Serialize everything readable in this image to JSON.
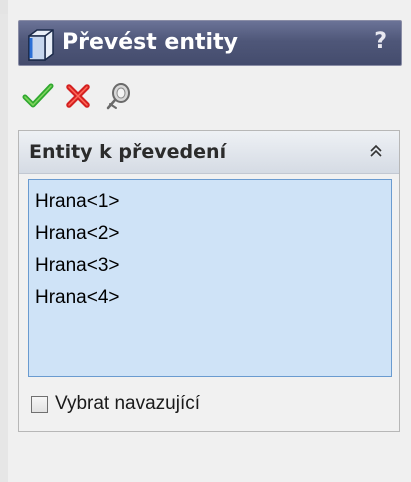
{
  "panel": {
    "title": "Převést entity",
    "help_label": "?"
  },
  "toolbar": {
    "ok_icon": "checkmark-icon",
    "cancel_icon": "x-icon",
    "pushpin_icon": "pushpin-icon"
  },
  "group": {
    "title": "Entity k převedení",
    "items": [
      {
        "label": "Hrana<1>"
      },
      {
        "label": "Hrana<2>"
      },
      {
        "label": "Hrana<3>"
      },
      {
        "label": "Hrana<4>"
      }
    ],
    "checkbox_label": "Vybrat navazující",
    "checkbox_checked": false
  },
  "colors": {
    "titlebar": "#4f5779",
    "ok_green": "#2fa82f",
    "cancel_red": "#d42020",
    "list_bg": "#cfe3f7",
    "list_border": "#6a9bd0"
  }
}
